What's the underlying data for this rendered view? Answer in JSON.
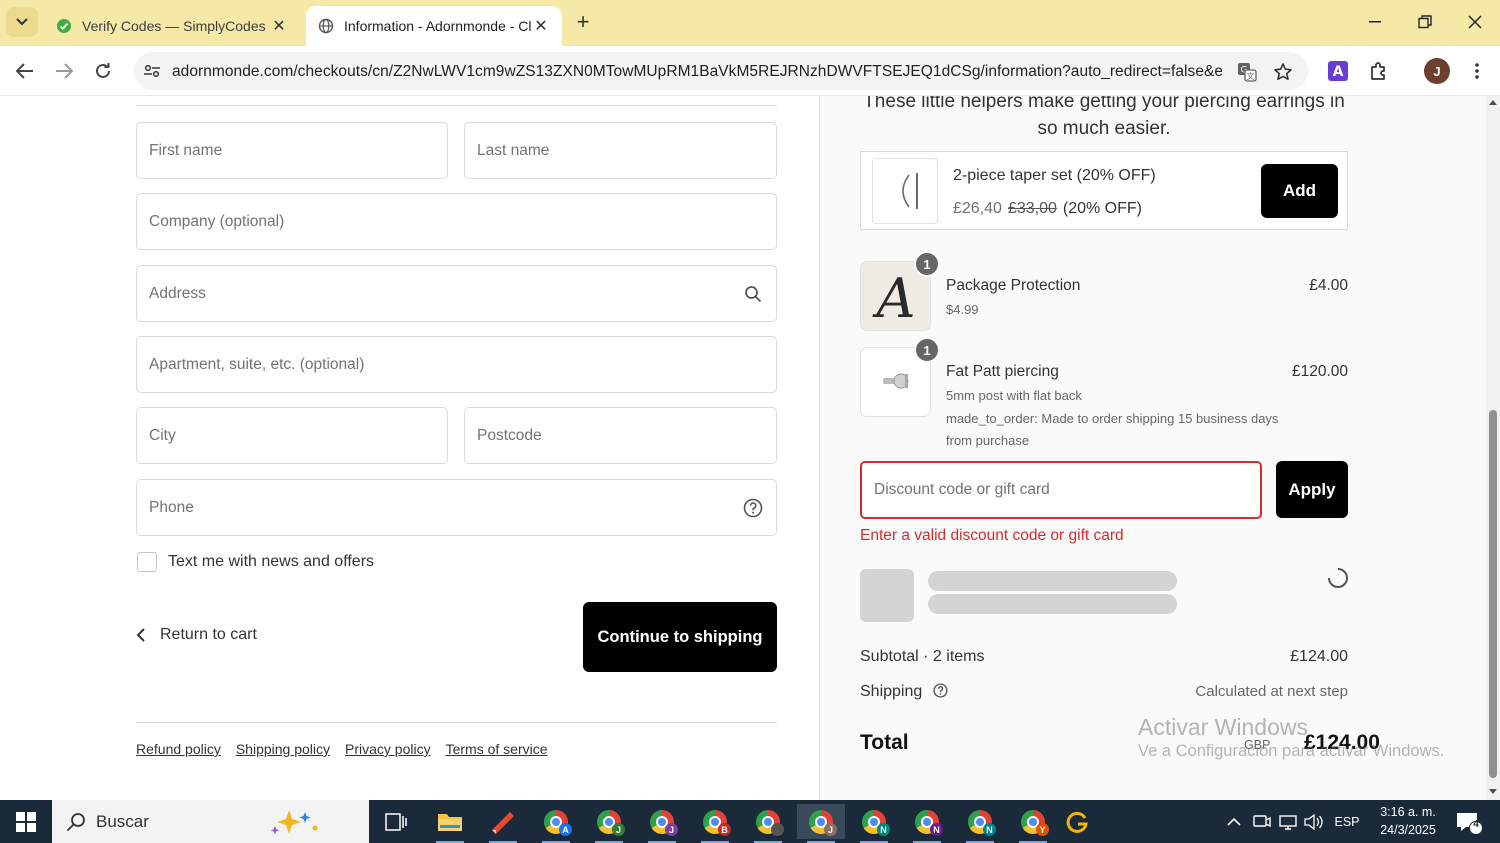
{
  "browser": {
    "tabs": [
      {
        "title": "Verify Codes — SimplyCodes",
        "active": false
      },
      {
        "title": "Information - Adornmonde - Cl",
        "active": true
      }
    ],
    "url": "adornmonde.com/checkouts/cn/Z2NwLWV1cm9wZS13ZXN0MTowMUpRM1BaVkM5REJRNzhDWVFTSEJEQ1dCSg/information?auto_redirect=false&edge...",
    "profile_initial": "J"
  },
  "form": {
    "first_name_placeholder": "First name",
    "last_name_placeholder": "Last name",
    "company_placeholder": "Company (optional)",
    "address_placeholder": "Address",
    "apartment_placeholder": "Apartment, suite, etc. (optional)",
    "city_placeholder": "City",
    "postcode_placeholder": "Postcode",
    "phone_placeholder": "Phone",
    "news_checkbox_label": "Text me with news and offers",
    "news_checked": false,
    "return_link": "Return to cart",
    "continue_button": "Continue to shipping"
  },
  "footer": {
    "links": [
      "Refund policy",
      "Shipping policy",
      "Privacy policy",
      "Terms of service"
    ]
  },
  "order_summary": {
    "upsell_text": "These little helpers make getting your piercing earrings in so much easier.",
    "upsell": {
      "name": "2-piece taper set (20% OFF)",
      "price": "£26,40",
      "compare_price": "£33,00",
      "discount_note": "(20% OFF)",
      "button": "Add"
    },
    "items": [
      {
        "name": "Package Protection",
        "qty": "1",
        "details": [
          "$4.99"
        ],
        "price": "£4.00",
        "thumb_letter": "A"
      },
      {
        "name": "Fat Patt piercing",
        "qty": "1",
        "details": [
          "5mm post with flat back",
          "made_to_order: Made to order shipping 15 business days from purchase"
        ],
        "price": "£120.00"
      }
    ],
    "discount_placeholder": "Discount code or gift card",
    "apply_button": "Apply",
    "discount_error": "Enter a valid discount code or gift card",
    "subtotal_label": "Subtotal · 2 items",
    "subtotal_value": "£124.00",
    "shipping_label": "Shipping",
    "shipping_value": "Calculated at next step",
    "total_label": "Total",
    "total_currency": "GBP",
    "total_value": "£124.00"
  },
  "watermark": {
    "line1": "Activar Windows",
    "line2": "Ve a Configuración para activar Windows."
  },
  "taskbar": {
    "search_label": "Buscar",
    "language": "ESP",
    "time": "3:16 a. m.",
    "date": "24/3/2025",
    "notification_count": "4",
    "chrome_badges": [
      "A",
      "J",
      "J",
      "B",
      "",
      "J",
      "N",
      "N",
      "N",
      "Y"
    ]
  },
  "colors": {
    "tab_bar": "#f6e9a7",
    "error": "#d82c2c",
    "button": "#000000",
    "taskbar": "#1b2a3a"
  }
}
